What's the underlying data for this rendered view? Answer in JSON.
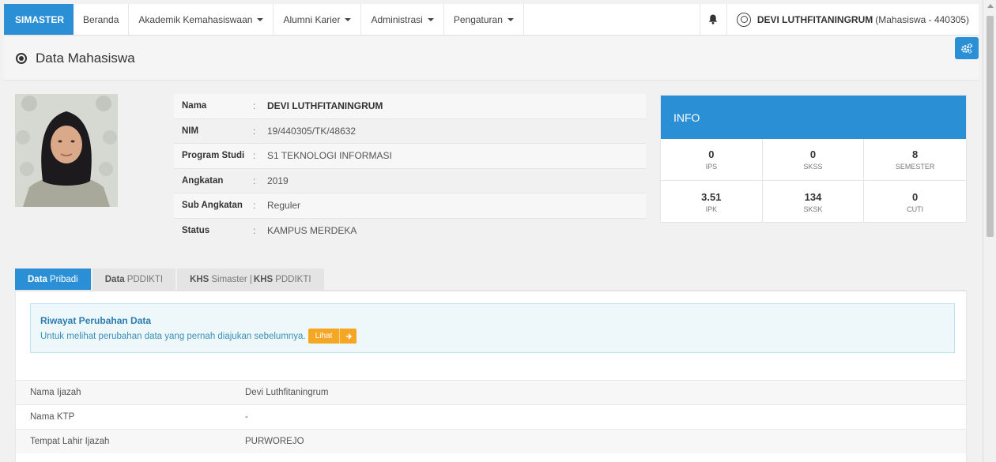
{
  "nav": {
    "brand": "SIMASTER",
    "items": [
      {
        "label": "Beranda",
        "caret": false
      },
      {
        "label": "Akademik Kemahasiswaan",
        "caret": true
      },
      {
        "label": "Alumni Karier",
        "caret": true
      },
      {
        "label": "Administrasi",
        "caret": true
      },
      {
        "label": "Pengaturan",
        "caret": true
      }
    ],
    "user_name": "DEVI LUTHFITANINGRUM",
    "user_role": "(Mahasiswa - 440305)"
  },
  "page": {
    "title": "Data Mahasiswa"
  },
  "profile": {
    "rows": [
      {
        "label": "Nama",
        "value": "DEVI LUTHFITANINGRUM"
      },
      {
        "label": "NIM",
        "value": "19/440305/TK/48632"
      },
      {
        "label": "Program Studi",
        "value": "S1 TEKNOLOGI INFORMASI"
      },
      {
        "label": "Angkatan",
        "value": "2019"
      },
      {
        "label": "Sub Angkatan",
        "value": "Reguler"
      },
      {
        "label": "Status",
        "value": "KAMPUS MERDEKA"
      }
    ],
    "separator": ":"
  },
  "info": {
    "title": "INFO",
    "cells": [
      {
        "value": "0",
        "caption": "IPS"
      },
      {
        "value": "0",
        "caption": "SKSS"
      },
      {
        "value": "8",
        "caption": "SEMESTER"
      },
      {
        "value": "3.51",
        "caption": "IPK"
      },
      {
        "value": "134",
        "caption": "SKSK"
      },
      {
        "value": "0",
        "caption": "CUTI"
      }
    ]
  },
  "tabs": [
    {
      "bold": "Data",
      "rest": "Pribadi",
      "active": true
    },
    {
      "bold": "Data",
      "rest": "PDDIKTI",
      "active": false
    },
    {
      "bold": "KHS",
      "rest": "Simaster |",
      "bold2": "KHS",
      "rest2": "PDDIKTI",
      "active": false
    }
  ],
  "alert": {
    "title": "Riwayat Perubahan Data",
    "text": "Untuk melihat perubahan data yang pernah diajukan sebelumnya.",
    "button": "Lihat"
  },
  "details": [
    {
      "label": "Nama Ijazah",
      "value": "Devi Luthfitaningrum"
    },
    {
      "label": "Nama KTP",
      "value": "-"
    },
    {
      "label": "Tempat Lahir Ijazah",
      "value": "PURWOREJO"
    }
  ],
  "colors": {
    "primary": "#2b8fd6",
    "warning": "#f5a623",
    "alert_bg": "#eef8fa"
  }
}
